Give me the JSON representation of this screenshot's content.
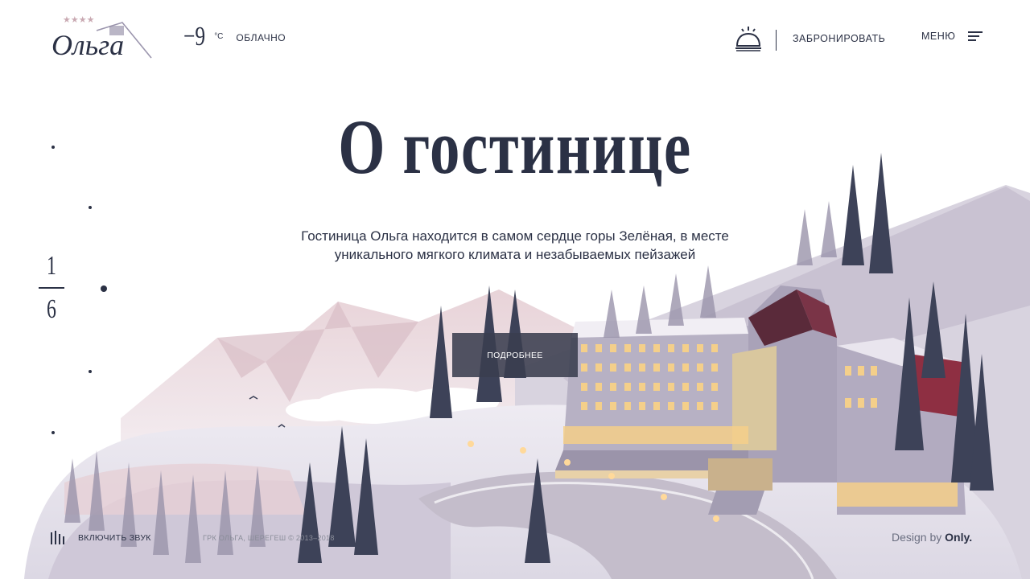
{
  "header": {
    "logo_text": "Ольга",
    "logo_stars": "★★★★",
    "weather": {
      "temperature": "−9",
      "unit": "°С",
      "condition": "ОБЛАЧНО"
    },
    "booking_label": "ЗАБРОНИРОВАТЬ",
    "menu_label": "МЕНЮ",
    "icons": {
      "booking": "reception-bell-icon",
      "menu": "hamburger-icon"
    }
  },
  "hero": {
    "title": "О гостинице",
    "lead": "Гостиница Ольга находится в самом сердце горы Зелёная, в месте уникального мягкого климата и незабываемых пейзажей",
    "button_label": "ПОДРОБНЕЕ"
  },
  "pager": {
    "current": "1",
    "total": "6"
  },
  "footer": {
    "sound_label": "ВКЛЮЧИТЬ ЗВУК",
    "copyright": "ГРК ОЛЬГА, ШЕРЕГЕШ © 2013–2018",
    "design_prefix": "Design by",
    "design_brand": "Only."
  },
  "colors": {
    "ink": "#2b3145",
    "button": "#3a3e4e",
    "snow": "#e9e6ee",
    "accent": "#6b2a3a"
  }
}
